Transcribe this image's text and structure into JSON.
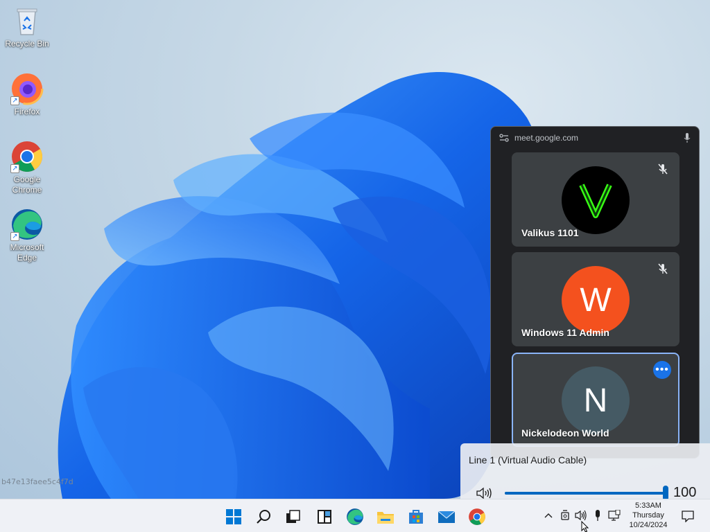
{
  "desktop": {
    "icons": [
      {
        "label": "Recycle Bin",
        "icon": "recycle-bin-icon"
      },
      {
        "label": "Firefox",
        "icon": "firefox-icon"
      },
      {
        "label": "Google Chrome",
        "icon": "chrome-icon"
      },
      {
        "label": "Microsoft Edge",
        "icon": "edge-icon"
      }
    ],
    "watermark": "b47e13faee5c4f7d"
  },
  "pip": {
    "title": "meet.google.com",
    "tiles": [
      {
        "name": "Valikus 1101",
        "initial": "V",
        "avatar_color": "#000000",
        "status": "muted"
      },
      {
        "name": "Windows 11 Admin",
        "initial": "W",
        "avatar_color": "#f4511e",
        "status": "muted"
      },
      {
        "name": "Nickelodeon World",
        "initial": "N",
        "avatar_color": "#455a64",
        "status": "active-speaker"
      }
    ],
    "more_label": "•••"
  },
  "volume": {
    "device": "Line 1 (Virtual Audio Cable)",
    "level": 100,
    "level_text": "100",
    "accent": "#0067c0"
  },
  "taskbar": {
    "apps": [
      "start-icon",
      "search-icon",
      "task-view-icon",
      "widgets-icon",
      "edge-icon",
      "file-explorer-icon",
      "store-icon",
      "mail-icon",
      "chrome-icon"
    ],
    "tray": [
      "show-hidden-icons-chevron",
      "camera-in-use-icon",
      "speaker-icon",
      "microphone-icon",
      "network-icon"
    ],
    "time": "5:33AM",
    "day": "Thursday",
    "date": "10/24/2024"
  }
}
